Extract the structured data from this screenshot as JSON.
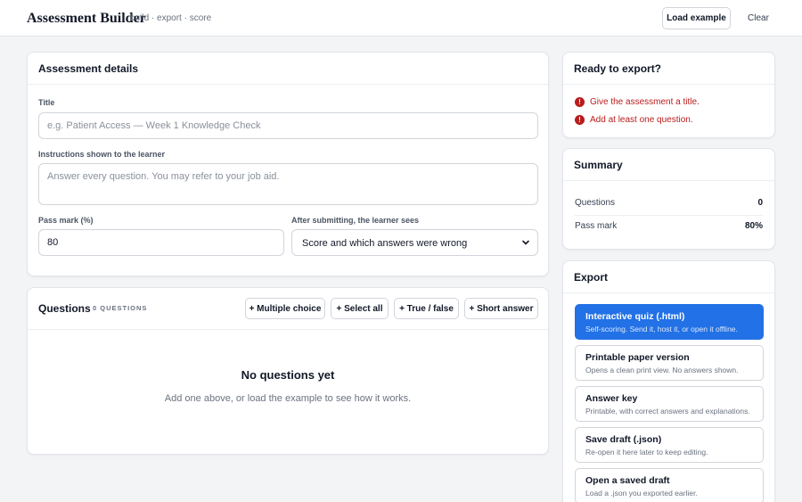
{
  "header": {
    "app_title": "Assessment Builder",
    "tagline": "build · export · score",
    "load_example_label": "Load example",
    "clear_label": "Clear"
  },
  "details": {
    "heading": "Assessment details",
    "title_label": "Title",
    "title_placeholder": "e.g. Patient Access — Week 1 Knowledge Check",
    "title_value": "",
    "instructions_label": "Instructions shown to the learner",
    "instructions_placeholder": "Answer every question. You may refer to your job aid.",
    "instructions_value": "",
    "pass_mark_label": "Pass mark (%)",
    "pass_mark_value": "80",
    "after_submit_label": "After submitting, the learner sees",
    "after_submit_selected": "Score and which answers were wrong"
  },
  "questions": {
    "heading": "Questions",
    "count_label": "0 QUESTIONS",
    "add_multiple_choice": "+ Multiple choice",
    "add_select_all": "+ Select all",
    "add_true_false": "+ True / false",
    "add_short_answer": "+ Short answer",
    "empty_title": "No questions yet",
    "empty_text": "Add one above, or load the example to see how it works."
  },
  "ready": {
    "heading": "Ready to export?",
    "errors": [
      "Give the assessment a title.",
      "Add at least one question."
    ],
    "error_icon": "alert-circle-icon",
    "error_color": "#b91c1c"
  },
  "summary": {
    "heading": "Summary",
    "rows": [
      {
        "label": "Questions",
        "value": "0"
      },
      {
        "label": "Pass mark",
        "value": "80%"
      }
    ]
  },
  "export": {
    "heading": "Export",
    "options": [
      {
        "title": "Interactive quiz (.html)",
        "desc": "Self-scoring. Send it, host it, or open it offline."
      },
      {
        "title": "Printable paper version",
        "desc": "Opens a clean print view. No answers shown."
      },
      {
        "title": "Answer key",
        "desc": "Printable, with correct answers and explanations."
      },
      {
        "title": "Save draft (.json)",
        "desc": "Re-open it here later to keep editing."
      },
      {
        "title": "Open a saved draft",
        "desc": "Load a .json you exported earlier."
      }
    ],
    "primary_color": "#2271e6"
  }
}
